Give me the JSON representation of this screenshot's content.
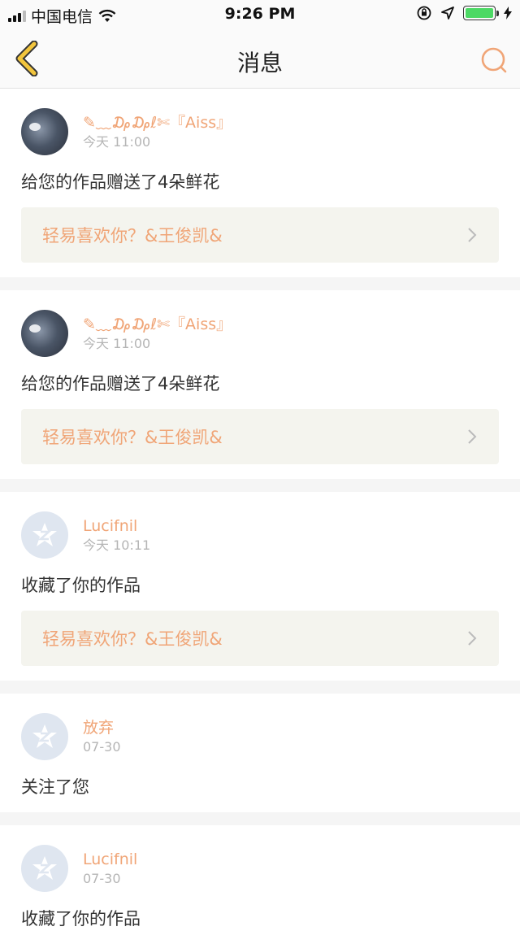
{
  "status_bar": {
    "carrier": "中国电信",
    "time": "9:26 PM"
  },
  "header": {
    "title": "消息"
  },
  "messages": [
    {
      "username": "✎﹏₯₯ℓ✄『Aiss』",
      "time": "今天 11:00",
      "text": "给您的作品赠送了4朵鲜花",
      "work_title": "轻易喜欢你？&王俊凯&",
      "avatar": "photo"
    },
    {
      "username": "✎﹏₯₯ℓ✄『Aiss』",
      "time": "今天 11:00",
      "text": "给您的作品赠送了4朵鲜花",
      "work_title": "轻易喜欢你？&王俊凯&",
      "avatar": "photo"
    },
    {
      "username": "Lucifnil",
      "time": "今天 10:11",
      "text": "收藏了你的作品",
      "work_title": "轻易喜欢你？&王俊凯&",
      "avatar": "default"
    },
    {
      "username": "放弃",
      "time": "07-30",
      "text": "关注了您",
      "avatar": "default"
    },
    {
      "username": "Lucifnil",
      "time": "07-30",
      "text": "收藏了你的作品",
      "avatar": "default"
    }
  ],
  "colors": {
    "accent": "#f0a577",
    "back_icon": "#e8b020",
    "battery": "#4cd964"
  }
}
